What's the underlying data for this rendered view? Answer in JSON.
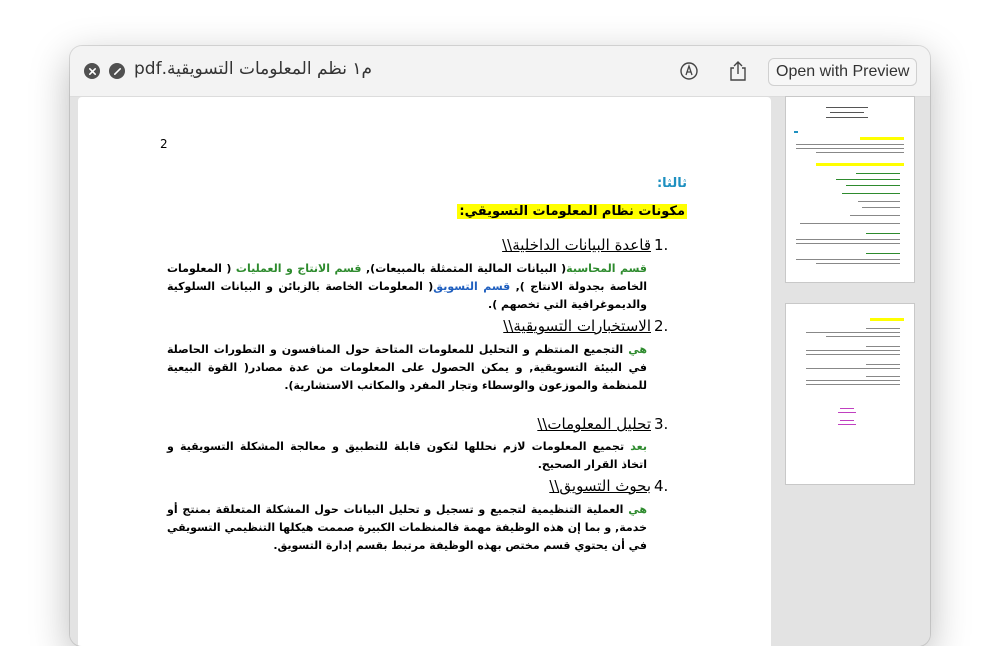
{
  "window": {
    "title": "م١ نظم المعلومات التسويقية.pdf",
    "open_with_preview": "Open with Preview"
  },
  "page": {
    "number": "2",
    "third_label": "ثالثا:",
    "heading": "مكونات نظام المعلومات التسويقي:",
    "sections": [
      {
        "num": "1.",
        "title": "قاعدة البيانات الداخلية\\\\",
        "parts": [
          {
            "text": "قسم المحاسبة",
            "color": "green"
          },
          {
            "text": "( البيانات المالية المتمثلة بالمبيعات), ",
            "color": "black"
          },
          {
            "text": "قسم الانتاج و العمليات",
            "color": "green"
          },
          {
            "text": " ( المعلومات الخاصة بجدولة الانتاج ), ",
            "color": "black"
          },
          {
            "text": "قسم التسويق",
            "color": "blue"
          },
          {
            "text": "( المعلومات الخاصة بالزبائن و البيانات السلوكية والديموغرافية التي تخصهم ).",
            "color": "black"
          }
        ]
      },
      {
        "num": "2.",
        "title": "الاستخبارات التسويقية\\\\",
        "parts": [
          {
            "text": "هي",
            "color": "green"
          },
          {
            "text": " التجميع المنتظم و التحليل للمعلومات المتاحة حول المنافسون و التطورات الحاصلة في البيئة التسويقية, و يمكن الحصول على المعلومات من عدة مصادر( القوة البيعية للمنظمة والموزعون والوسطاء وتجار المفرد والمكاتب الاستشارية).",
            "color": "black"
          }
        ]
      },
      {
        "num": "3.",
        "title": "تحليل المعلومات\\\\",
        "parts": [
          {
            "text": "بعد",
            "color": "green"
          },
          {
            "text": " تجميع المعلومات لازم نحللها لتكون قابلة للتطبيق و معالجة المشكلة التسويقية و اتخاذ القرار الصحيح.",
            "color": "black"
          }
        ]
      },
      {
        "num": "4.",
        "title": "بحوث التسويق\\\\",
        "parts": [
          {
            "text": "هي",
            "color": "green"
          },
          {
            "text": " العملية التنظيمية لتجميع و تسجيل و تحليل البيانات حول المشكلة المتعلقة بمنتج أو خدمة, و بما إن هذه الوظيفة مهمة فالمنظمات الكبيرة صممت هيكلها التنظيمي التسويقي في أن يحتوي قسم مختص بهذه الوظيفة مرتبط بقسم إدارة التسويق.",
            "color": "black"
          }
        ]
      }
    ]
  },
  "icons": [
    "close-icon",
    "minimize-icon",
    "markup-icon",
    "share-icon"
  ],
  "colors": {
    "accent_green": "#2e8b2e",
    "accent_blue": "#1f5fbf",
    "highlight": "#ffff00",
    "label_blue": "#1e90c0"
  }
}
